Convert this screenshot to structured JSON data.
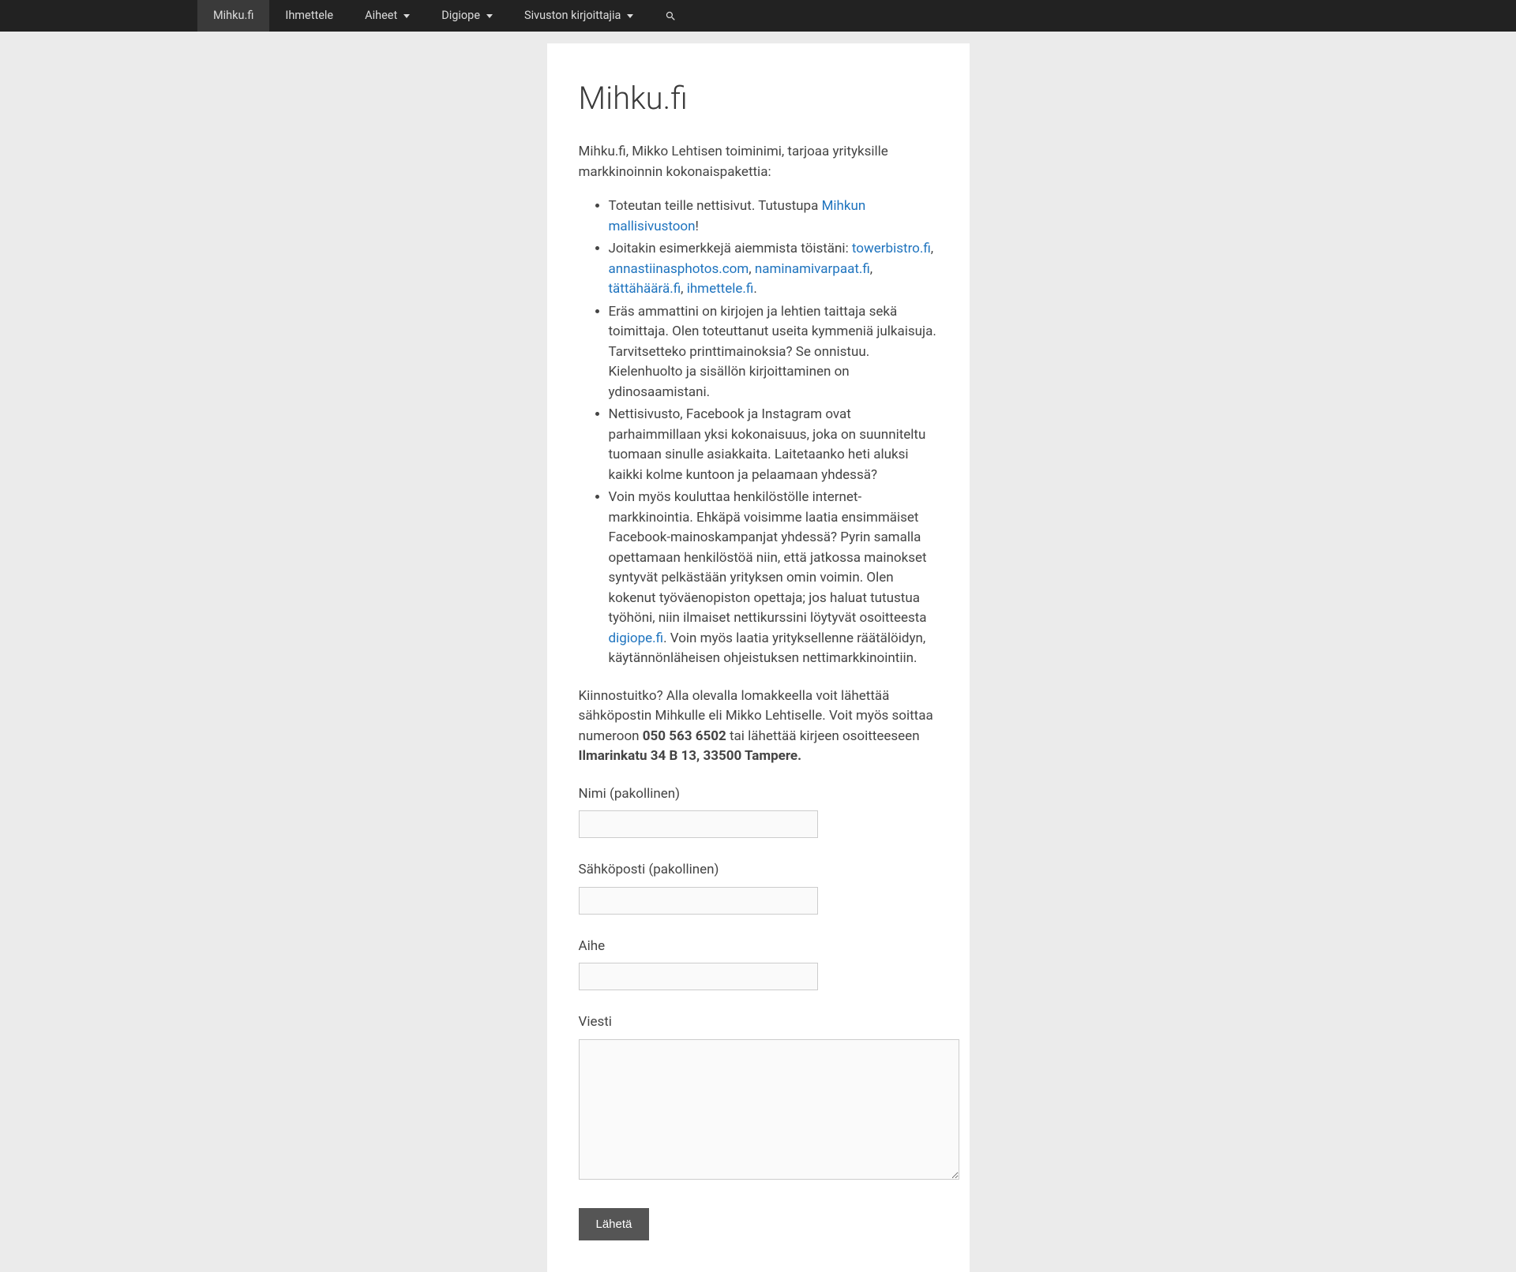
{
  "nav": {
    "items": [
      {
        "label": "Mihku.fi",
        "active": true,
        "hasDropdown": false
      },
      {
        "label": "Ihmettele",
        "active": false,
        "hasDropdown": false
      },
      {
        "label": "Aiheet",
        "active": false,
        "hasDropdown": true
      },
      {
        "label": "Digiope",
        "active": false,
        "hasDropdown": true
      },
      {
        "label": "Sivuston kirjoittajia",
        "active": false,
        "hasDropdown": true
      }
    ]
  },
  "page": {
    "title": "Mihku.fi",
    "intro": "Mihku.fi, Mikko Lehtisen toiminimi, tarjoaa yrityksille markkinoinnin kokonaispakettia:",
    "li1_pre": "Toteutan teille nettisivut. Tutustupa ",
    "li1_link": "Mihkun mallisivustoon",
    "li1_post": "!",
    "li2_pre": "Joitakin esimerkkejä aiemmista töistäni: ",
    "li2_link1": "towerbistro.fi",
    "li2_sep1": ", ",
    "li2_link2": "annastiinasphotos.com",
    "li2_sep2": ", ",
    "li2_link3": "naminamivarpaat.fi",
    "li2_sep3": ", ",
    "li2_link4": "tättähäärä.fi",
    "li2_sep4": ", ",
    "li2_link5": "ihmettele.fi",
    "li2_post": ".",
    "li3": "Eräs ammattini on kirjojen ja lehtien taittaja sekä toimittaja. Olen toteuttanut useita kymmeniä julkaisuja. Tarvitsetteko printtimainoksia? Se onnistuu. Kielenhuolto ja sisällön kirjoittaminen on ydinosaamistani.",
    "li4": "Nettisivusto, Facebook ja Instagram ovat parhaimmillaan yksi kokonaisuus, joka on suunniteltu tuomaan sinulle asiakkaita. Laitetaanko heti aluksi kaikki kolme kuntoon ja pelaamaan yhdessä?",
    "li5_pre": "Voin myös kouluttaa henkilöstölle internet-markkinointia. Ehkäpä voisimme laatia ensimmäiset Facebook-mainoskampanjat yhdessä? Pyrin samalla opettamaan henkilöstöä niin, että jatkossa mainokset syntyvät pelkästään yrityksen omin voimin. Olen kokenut työväenopiston opettaja; jos haluat tutustua työhöni, niin ilmaiset nettikurssini löytyvät osoitteesta ",
    "li5_link": "digiope.fi",
    "li5_post": ". Voin myös laatia yrityksellenne räätälöidyn, käytännönläheisen ohjeistuksen nettimarkkinointiin.",
    "contact_pre": "Kiinnostuitko? Alla olevalla lomakkeella voit lähettää sähköpostin Mihkulle eli Mikko Lehtiselle. Voit myös soittaa numeroon ",
    "contact_phone": "050 563 6502",
    "contact_mid": " tai lähettää kirjeen osoitteeseen ",
    "contact_address": "Ilmarinkatu 34 B 13, 33500 Tampere."
  },
  "form": {
    "name_label": "Nimi (pakollinen)",
    "email_label": "Sähköposti (pakollinen)",
    "subject_label": "Aihe",
    "message_label": "Viesti",
    "submit_label": "Lähetä"
  }
}
